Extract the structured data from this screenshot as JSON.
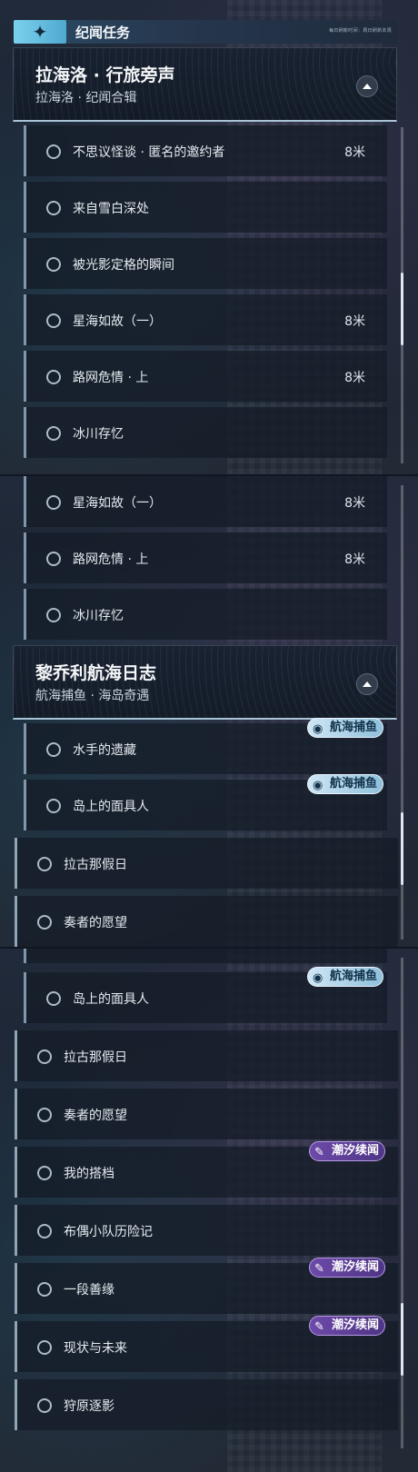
{
  "header": {
    "icon": "sparkle-icon",
    "title": "纪闻任务",
    "right_text": "每日刷新时间：周日刷新本周"
  },
  "group1": {
    "title": "拉海洛 · 行旅旁声",
    "subtitle": "拉海洛 · 纪闻合辑"
  },
  "group2": {
    "title": "黎乔利航海日志",
    "subtitle": "航海捕鱼 · 海岛奇遇"
  },
  "seg1_rows": [
    {
      "label": "不思议怪谈 · 匿名的邀约者",
      "dist": "8米"
    },
    {
      "label": "来自雪白深处",
      "dist": ""
    },
    {
      "label": "被光影定格的瞬间",
      "dist": ""
    },
    {
      "label": "星海如故（一）",
      "dist": "8米"
    },
    {
      "label": "路网危情 · 上",
      "dist": "8米"
    },
    {
      "label": "冰川存忆",
      "dist": ""
    }
  ],
  "seg2_rows": [
    {
      "label": "星海如故（一）",
      "dist": "8米"
    },
    {
      "label": "路网危情 · 上",
      "dist": "8米"
    },
    {
      "label": "冰川存忆",
      "dist": ""
    }
  ],
  "seg2_group_rows": [
    {
      "label": "水手的遗藏"
    },
    {
      "label": "岛上的面具人"
    },
    {
      "label": "拉古那假日"
    },
    {
      "label": "奏者的愿望"
    }
  ],
  "seg3_rows": [
    {
      "label": "岛上的面具人"
    },
    {
      "label": "拉古那假日"
    },
    {
      "label": "奏者的愿望"
    },
    {
      "label": "我的搭档"
    },
    {
      "label": "布偶小队历险记"
    },
    {
      "label": "一段善缘"
    },
    {
      "label": "现状与未来"
    },
    {
      "label": "狩原逐影"
    }
  ],
  "badges": {
    "fishing": "航海捕鱼",
    "tide": "潮汐续闻"
  }
}
